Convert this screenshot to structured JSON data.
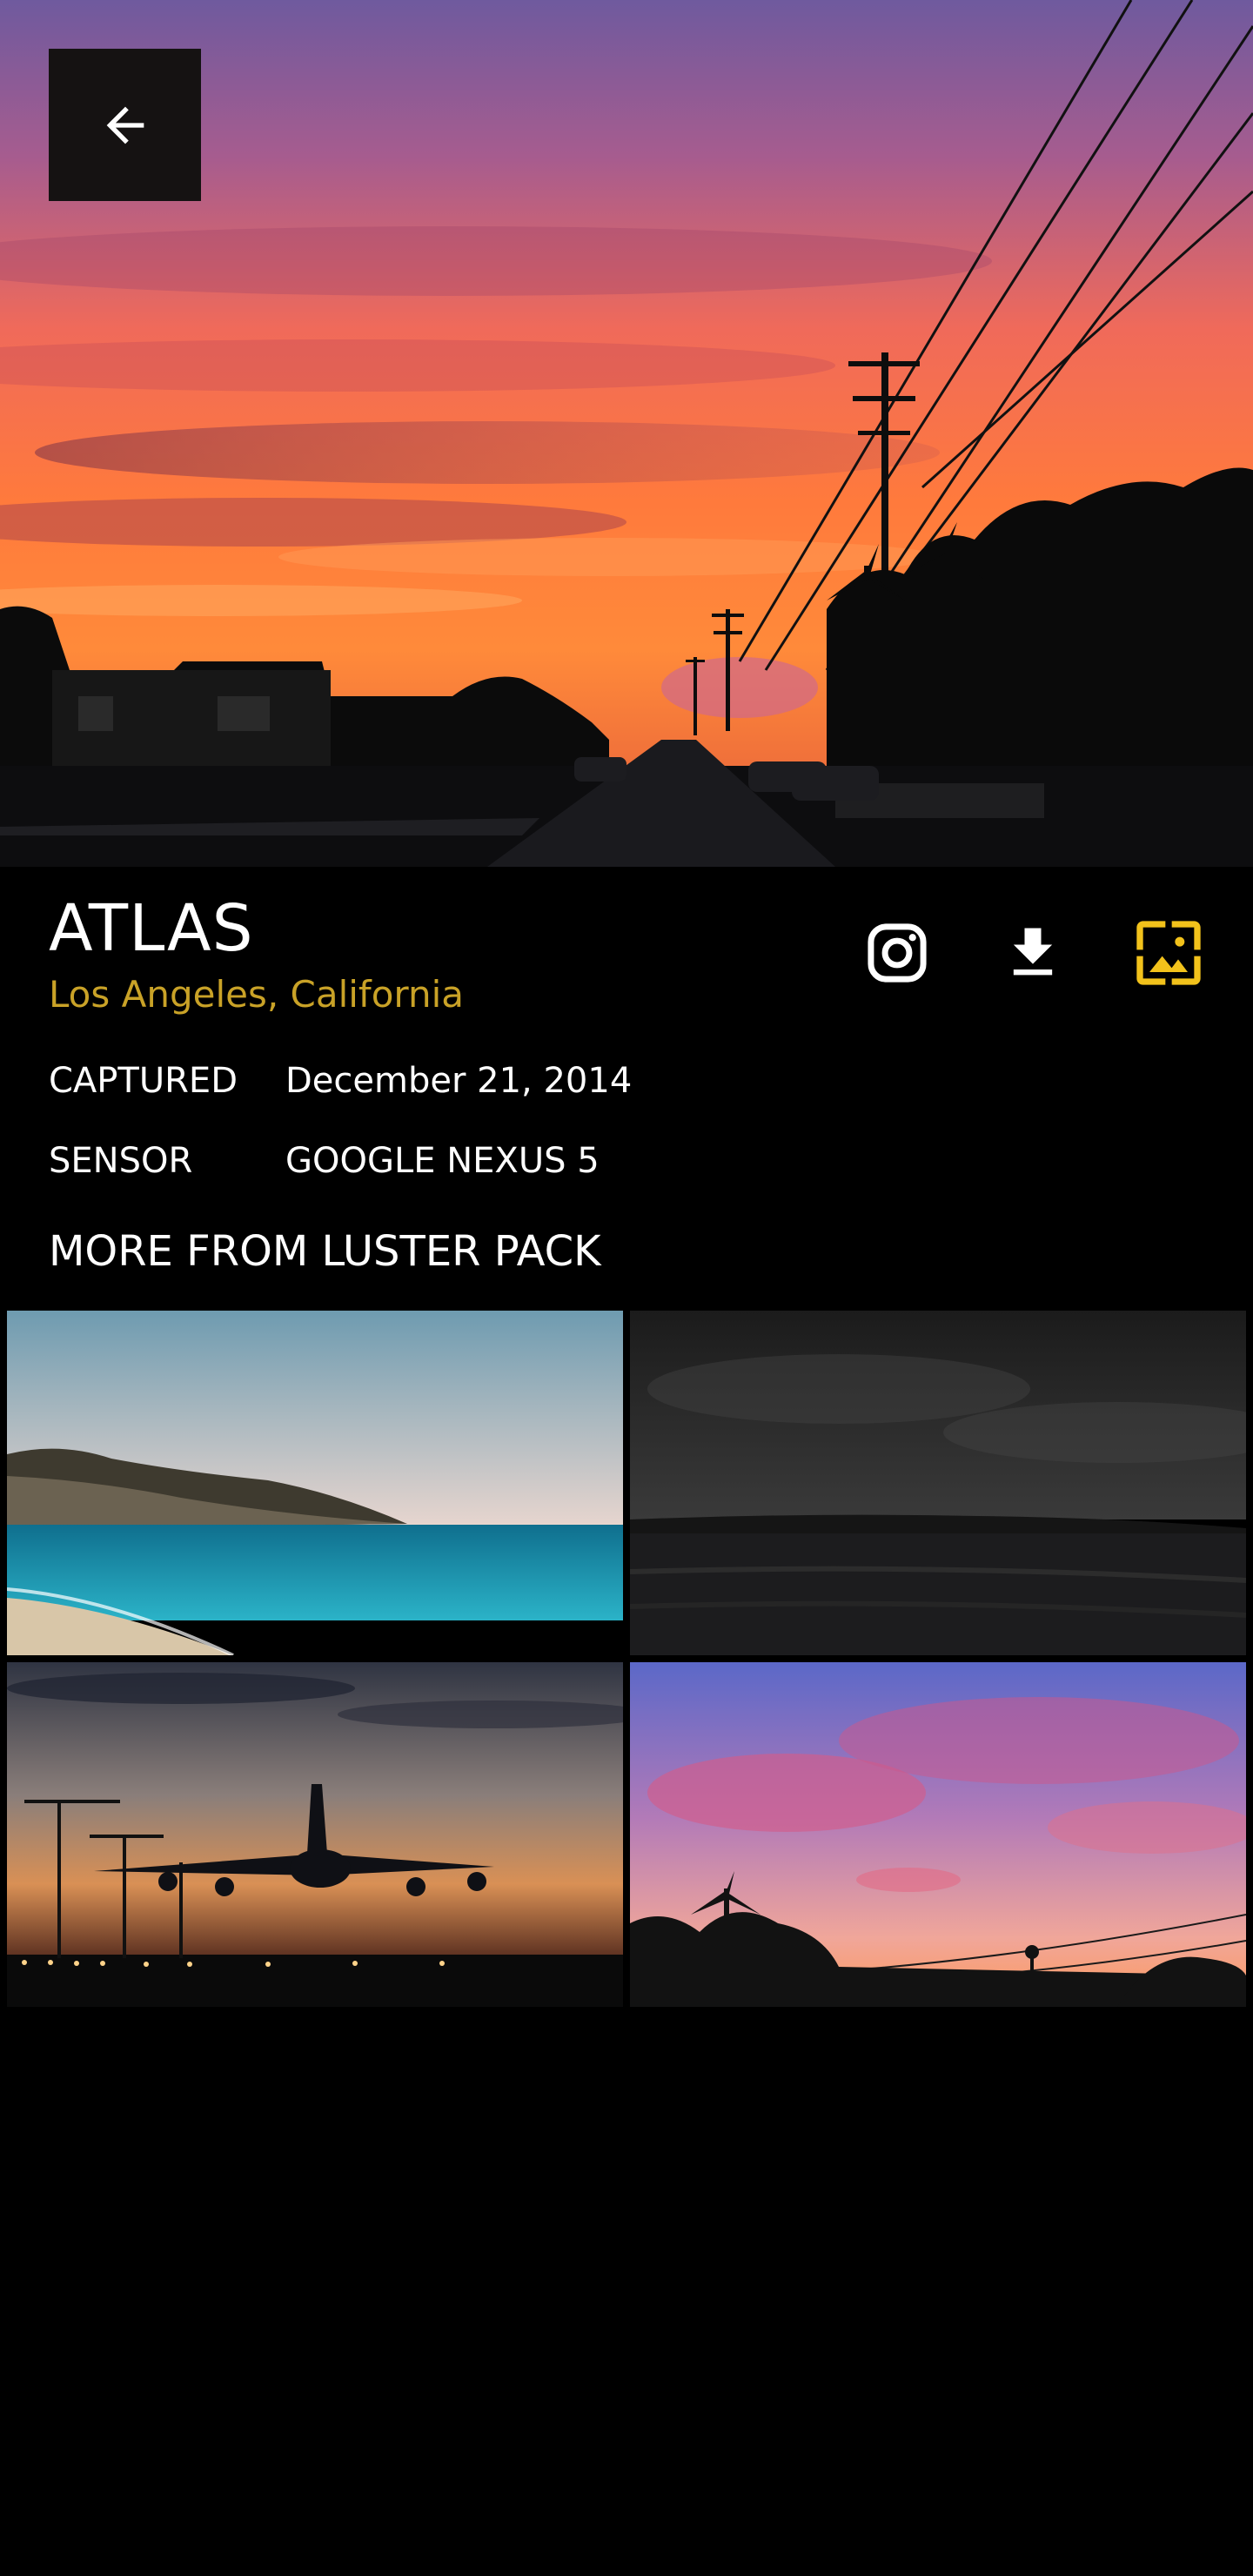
{
  "photo": {
    "title": "ATLAS",
    "location": "Los Angeles, California",
    "accent_color": "#C9A227",
    "meta": [
      {
        "label": "CAPTURED",
        "value": "December 21, 2014"
      },
      {
        "label": "SENSOR",
        "value": "GOOGLE NEXUS 5"
      }
    ]
  },
  "toolbar": {
    "back_icon": "arrow-left-icon",
    "actions": [
      {
        "name": "instagram",
        "icon": "instagram-icon"
      },
      {
        "name": "download",
        "icon": "download-icon"
      },
      {
        "name": "set-wallpaper",
        "icon": "set-wallpaper-icon",
        "active": true
      }
    ]
  },
  "more_section": {
    "title": "MORE FROM LUSTER PACK",
    "thumbnails": [
      {
        "scene": "coastline-beach"
      },
      {
        "scene": "night-ocean"
      },
      {
        "scene": "airplane-sunset"
      },
      {
        "scene": "pink-sky-palms"
      }
    ]
  }
}
